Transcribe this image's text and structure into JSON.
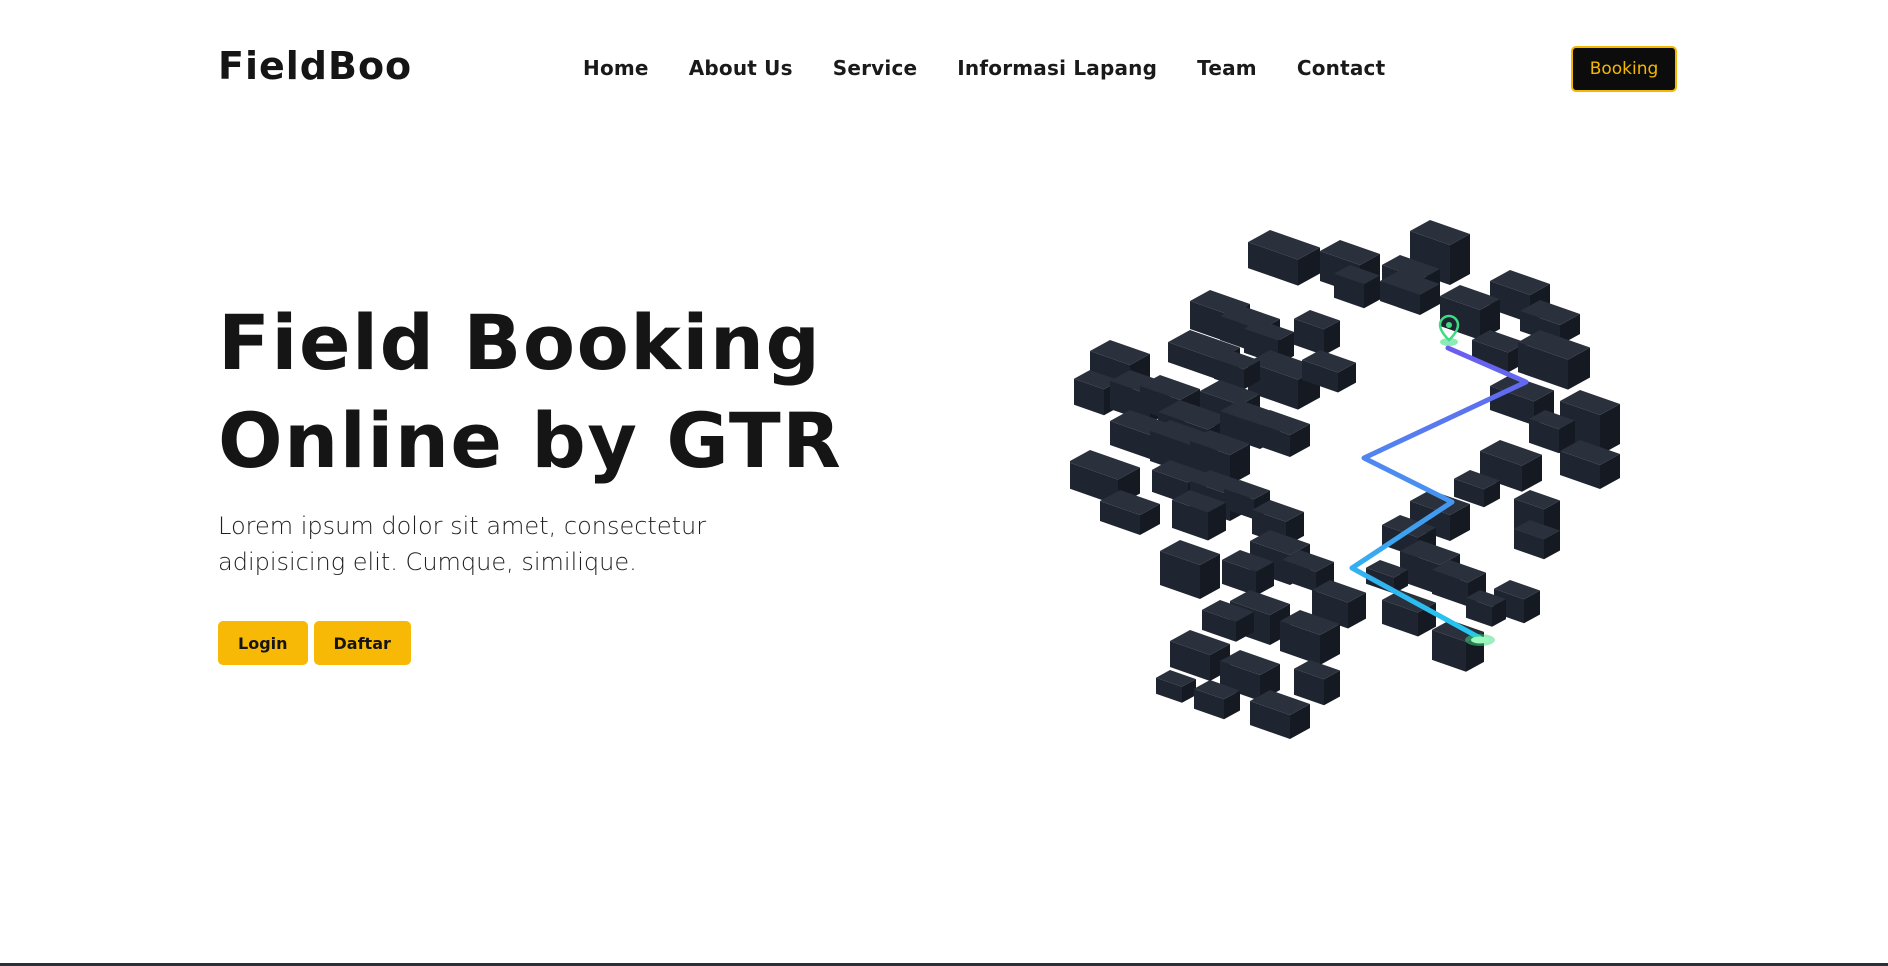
{
  "brand": {
    "name": "FieldBoo"
  },
  "nav": {
    "items": [
      {
        "label": "Home"
      },
      {
        "label": "About Us"
      },
      {
        "label": "Service"
      },
      {
        "label": "Informasi Lapang"
      },
      {
        "label": "Team"
      },
      {
        "label": "Contact"
      }
    ],
    "cta_label": "Booking"
  },
  "hero": {
    "title_line1": "Field Booking",
    "title_line2": "Online by GTR",
    "text": "Lorem ipsum dolor sit amet, consectetur adipisicing elit. Cumque, similique.",
    "login_label": "Login",
    "register_label": "Daftar",
    "illustration_icon": "isometric-city-route-icon"
  },
  "colors": {
    "accent": "#f8b906",
    "dark": "#151515",
    "block_top": "#2a303c",
    "block_left": "#1e2430",
    "block_right": "#141922",
    "route_start": "#6b5cf0",
    "route_end": "#23c9f0",
    "pin": "#3ddc84"
  }
}
